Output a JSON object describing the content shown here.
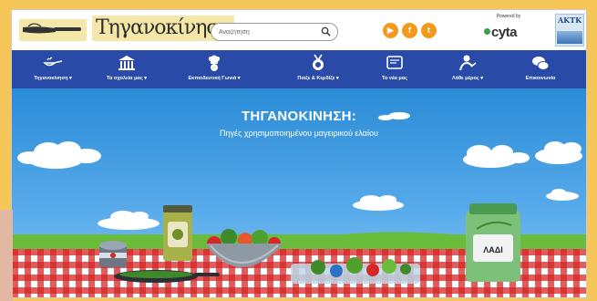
{
  "header": {
    "logo_text": "Τηγανοκίνηση",
    "search": {
      "placeholder": "Αναζήτηση"
    },
    "social_icons": [
      "youtube-icon",
      "facebook-icon",
      "twitter-icon"
    ],
    "sponsor": {
      "label": "Powered by",
      "name": "cyta"
    },
    "partner_logo_text": "AKTK"
  },
  "nav": {
    "items": [
      {
        "label": "Τηγανοκίνηση ▾",
        "icon": "frying-pan-icon"
      },
      {
        "label": "Τα σχολεία μας ▾",
        "icon": "school-building-icon"
      },
      {
        "label": "Εκπαιδευτική Γωνιά ▾",
        "icon": "chef-icon"
      },
      {
        "label": "Παιξε & Κερδίζε ▾",
        "icon": "medal-icon"
      },
      {
        "label": "Τα νέα μας",
        "icon": "newspaper-icon"
      },
      {
        "label": "Λάθε μέρος ▾",
        "icon": "person-icon"
      },
      {
        "label": "Επικοινωνία",
        "icon": "chat-bubbles-icon"
      }
    ]
  },
  "hero": {
    "title": "ΤΗΓΑΝΟΚΙΝΗΣΗ:",
    "subtitle": "Πηγές χρησιμοποιημένου μαγειρικού ελαίου",
    "jar_label": "ΛΑΔΙ"
  },
  "colors": {
    "frame": "#f6c658",
    "nav": "#2a4aa8",
    "social": "#f39a1e",
    "sky": "#2a8bd6",
    "grass": "#6abd3a",
    "tablecloth_red": "#d62727"
  }
}
